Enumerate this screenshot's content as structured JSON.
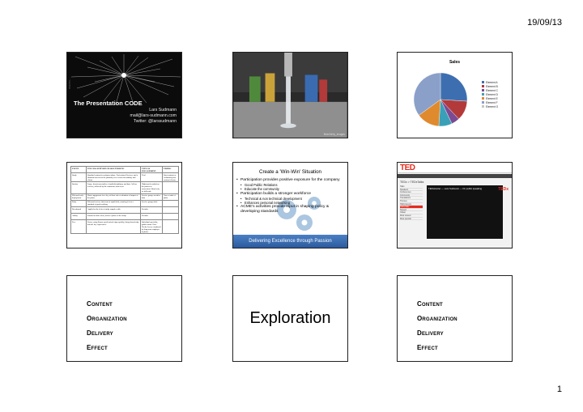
{
  "header": {
    "date": "19/09/13"
  },
  "footer": {
    "page_number": "1"
  },
  "slide1": {
    "title": "The Presentation CODE",
    "name": "Lars Sudmann",
    "email": "mail@lars-sudmann.com",
    "twitter": "Twitter: @larssudmann",
    "photo_credit": "PHOTO: ..."
  },
  "slide2": {
    "photo_credit": "flickr/kirby_images"
  },
  "slide3": {
    "chart_data": {
      "type": "pie",
      "title": "Sales",
      "categories": [
        "Element A",
        "Element B",
        "Element C",
        "Element D",
        "Element E",
        "Element F",
        "Element G"
      ],
      "values": [
        26,
        12,
        5,
        8,
        14,
        35,
        0
      ],
      "colors": [
        "#3d6fb0",
        "#b33a3a",
        "#7a4a92",
        "#3aa0b8",
        "#e08a2e",
        "#8aa0c8",
        "#c5c5c5"
      ],
      "legend_position": "right"
    }
  },
  "slide4": {
    "headers": [
      "EVENT",
      "TOUCH & SUPPORT CHARACTERISTIC",
      "TYPE OF ENGAGEMENT",
      "TIMING"
    ],
    "rows": [
      [
        "Study",
        "Standard contract/recruitment phase. Professional Services and a slimmed-for-cost of the platform, it is a focus for industry and clients.",
        "Trial",
        "Start contract or evaluation post-contract closure"
      ],
      [
        "Interim",
        "Large, short-term studies of multi-disciplinary and data. Ad-hoc reviews, followed by the contractor; first users.",
        "High-touch conduit on the phases of conversion. Short term, so full-scale.",
        ""
      ],
      [
        "Pilot and early deployment",
        "Short engagement for a key of those after evaluation of impact of the phase.",
        "Service group; sensitive data",
        "Once at start of phase"
      ],
      [
        "Early",
        "Pilot and review; first term of rapid ideal, ensuring it is at a standard of good working.",
        "Service group; ideal",
        ""
      ],
      [
        "Benchmark",
        "Applied to the fit in of study samples with.",
        "Periodic",
        ""
      ],
      [
        "Ability",
        "Pointed to other areas, before a phase of the study.",
        "Periodic",
        ""
      ],
      [
        "Peer",
        "Listen, using Ensure good trained signs quickly, brings knowledge into the key experiences.",
        "Individual specialist, public forms. Once Needs Access conducted by long-term employee in phase.",
        ""
      ]
    ]
  },
  "slide5": {
    "heading": "Create a 'Win-Win' Situation",
    "bullets": [
      {
        "text": "Participation provides positive exposure for the company",
        "sub": false
      },
      {
        "text": "Good Public Relations",
        "sub": true
      },
      {
        "text": "Educate the community",
        "sub": true
      },
      {
        "text": "Participation builds a stronger workforce",
        "sub": false
      },
      {
        "text": "Technical & non technical development",
        "sub": true
      },
      {
        "text": "Enhances personal networking",
        "sub": true
      },
      {
        "text": "ACME's activities provide input in shaping policy & developing standards",
        "sub": false
      }
    ],
    "banner": "Delivering Excellence through Passion"
  },
  "slide6": {
    "logo": "TED",
    "subtitle": "TEDx > TEDxTalks",
    "sidebar": [
      "Talks",
      "Speakers",
      "Conferences",
      "Community",
      "Translations",
      "Themes",
      "TEDx Events",
      "TEDxTalks",
      "Newest",
      "Oldest",
      "Most viewed",
      "Most popular"
    ],
    "video_label": "TEDxHunter — Lars Sudmann — On public speaking",
    "mini_logo": "TEDx"
  },
  "slide7": {
    "items": [
      "Content",
      "Organization",
      "Delivery",
      "Effect"
    ]
  },
  "slide8": {
    "word": "Exploration"
  },
  "slide9": {
    "items": [
      "Content",
      "Organization",
      "Delivery",
      "Effect"
    ]
  }
}
